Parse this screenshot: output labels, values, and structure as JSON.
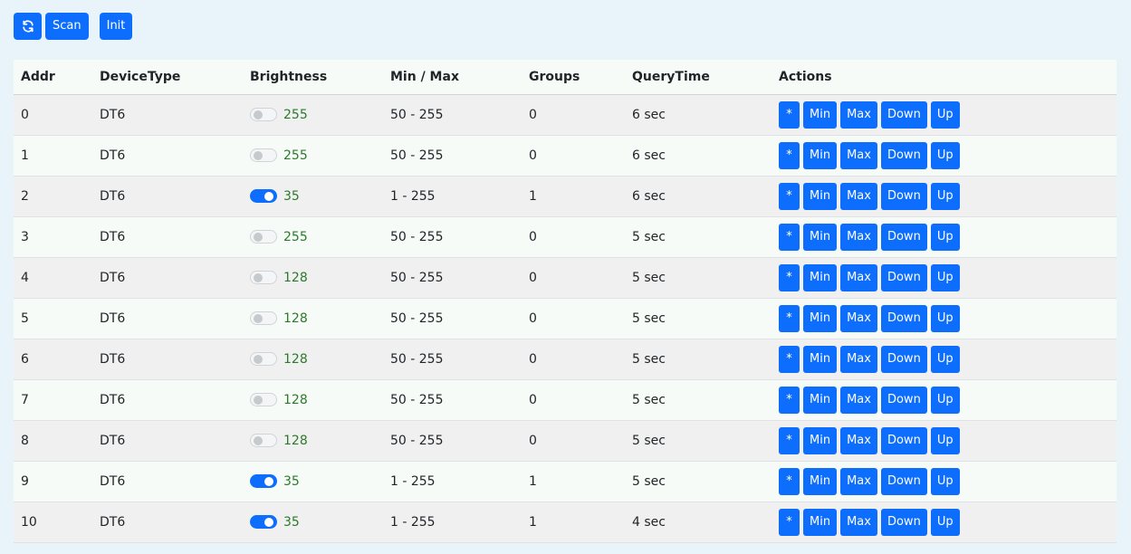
{
  "toolbar": {
    "refresh_icon": "refresh-icon",
    "scan_label": "Scan",
    "init_label": "Init"
  },
  "table": {
    "headers": [
      "Addr",
      "DeviceType",
      "Brightness",
      "Min / Max",
      "Groups",
      "QueryTime",
      "Actions"
    ],
    "action_labels": [
      "*",
      "Min",
      "Max",
      "Down",
      "Up"
    ],
    "rows": [
      {
        "addr": "0",
        "type": "DT6",
        "on": false,
        "brightness": "255",
        "minmax": "50 - 255",
        "groups": "0",
        "querytime": "6 sec"
      },
      {
        "addr": "1",
        "type": "DT6",
        "on": false,
        "brightness": "255",
        "minmax": "50 - 255",
        "groups": "0",
        "querytime": "6 sec"
      },
      {
        "addr": "2",
        "type": "DT6",
        "on": true,
        "brightness": "35",
        "minmax": "1 - 255",
        "groups": "1",
        "querytime": "6 sec"
      },
      {
        "addr": "3",
        "type": "DT6",
        "on": false,
        "brightness": "255",
        "minmax": "50 - 255",
        "groups": "0",
        "querytime": "5 sec"
      },
      {
        "addr": "4",
        "type": "DT6",
        "on": false,
        "brightness": "128",
        "minmax": "50 - 255",
        "groups": "0",
        "querytime": "5 sec"
      },
      {
        "addr": "5",
        "type": "DT6",
        "on": false,
        "brightness": "128",
        "minmax": "50 - 255",
        "groups": "0",
        "querytime": "5 sec"
      },
      {
        "addr": "6",
        "type": "DT6",
        "on": false,
        "brightness": "128",
        "minmax": "50 - 255",
        "groups": "0",
        "querytime": "5 sec"
      },
      {
        "addr": "7",
        "type": "DT6",
        "on": false,
        "brightness": "128",
        "minmax": "50 - 255",
        "groups": "0",
        "querytime": "5 sec"
      },
      {
        "addr": "8",
        "type": "DT6",
        "on": false,
        "brightness": "128",
        "minmax": "50 - 255",
        "groups": "0",
        "querytime": "5 sec"
      },
      {
        "addr": "9",
        "type": "DT6",
        "on": true,
        "brightness": "35",
        "minmax": "1 - 255",
        "groups": "1",
        "querytime": "5 sec"
      },
      {
        "addr": "10",
        "type": "DT6",
        "on": true,
        "brightness": "35",
        "minmax": "1 - 255",
        "groups": "1",
        "querytime": "4 sec"
      }
    ]
  },
  "colors": {
    "background": "#e8f3fa",
    "primary": "#0d6efd",
    "brightness_text": "#2b7a2b",
    "row_odd": "#f0f0f0",
    "row_even": "#f6fbf7"
  }
}
